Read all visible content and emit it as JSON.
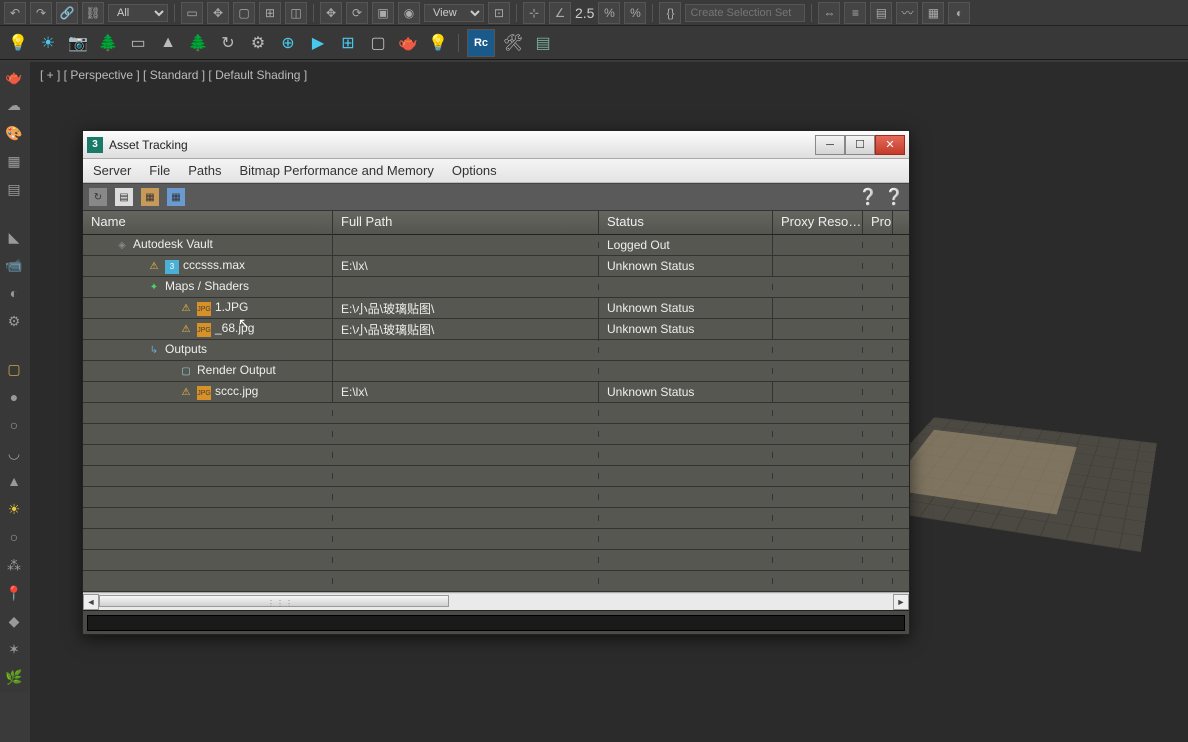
{
  "top": {
    "filter": "All",
    "view": "View",
    "zoom": "2.5",
    "selbox": "Create Selection Set"
  },
  "viewport": {
    "label": "[ + ] [ Perspective ] [ Standard ] [ Default Shading ]"
  },
  "window": {
    "title": "Asset Tracking",
    "menus": [
      "Server",
      "File",
      "Paths",
      "Bitmap Performance and Memory",
      "Options"
    ],
    "headers": {
      "name": "Name",
      "path": "Full Path",
      "status": "Status",
      "proxy": "Proxy Reso…",
      "prod": "Pro"
    },
    "rows": [
      {
        "name": "Autodesk Vault",
        "path": "",
        "status": "Logged Out",
        "indent": 1,
        "icon": "vault"
      },
      {
        "name": "cccsss.max",
        "path": "E:\\lx\\",
        "status": "Unknown Status",
        "indent": 2,
        "icon": "warn-file"
      },
      {
        "name": "Maps / Shaders",
        "path": "",
        "status": "",
        "indent": 2,
        "icon": "maps"
      },
      {
        "name": "1.JPG",
        "path": "E:\\小品\\玻璃贴图\\",
        "status": "Unknown Status",
        "indent": 3,
        "icon": "warn-jpg"
      },
      {
        "name": "_68.jpg",
        "path": "E:\\小品\\玻璃贴图\\",
        "status": "Unknown Status",
        "indent": 3,
        "icon": "warn-jpg"
      },
      {
        "name": "Outputs",
        "path": "",
        "status": "",
        "indent": 2,
        "icon": "out"
      },
      {
        "name": "Render Output",
        "path": "",
        "status": "",
        "indent": 3,
        "icon": "render"
      },
      {
        "name": "sccc.jpg",
        "path": "E:\\lx\\",
        "status": "Unknown Status",
        "indent": 3,
        "icon": "warn-jpg"
      },
      {
        "name": "",
        "path": "",
        "status": "",
        "indent": 0,
        "icon": ""
      },
      {
        "name": "",
        "path": "",
        "status": "",
        "indent": 0,
        "icon": ""
      },
      {
        "name": "",
        "path": "",
        "status": "",
        "indent": 0,
        "icon": ""
      },
      {
        "name": "",
        "path": "",
        "status": "",
        "indent": 0,
        "icon": ""
      },
      {
        "name": "",
        "path": "",
        "status": "",
        "indent": 0,
        "icon": ""
      },
      {
        "name": "",
        "path": "",
        "status": "",
        "indent": 0,
        "icon": ""
      },
      {
        "name": "",
        "path": "",
        "status": "",
        "indent": 0,
        "icon": ""
      },
      {
        "name": "",
        "path": "",
        "status": "",
        "indent": 0,
        "icon": ""
      },
      {
        "name": "",
        "path": "",
        "status": "",
        "indent": 0,
        "icon": ""
      }
    ]
  }
}
